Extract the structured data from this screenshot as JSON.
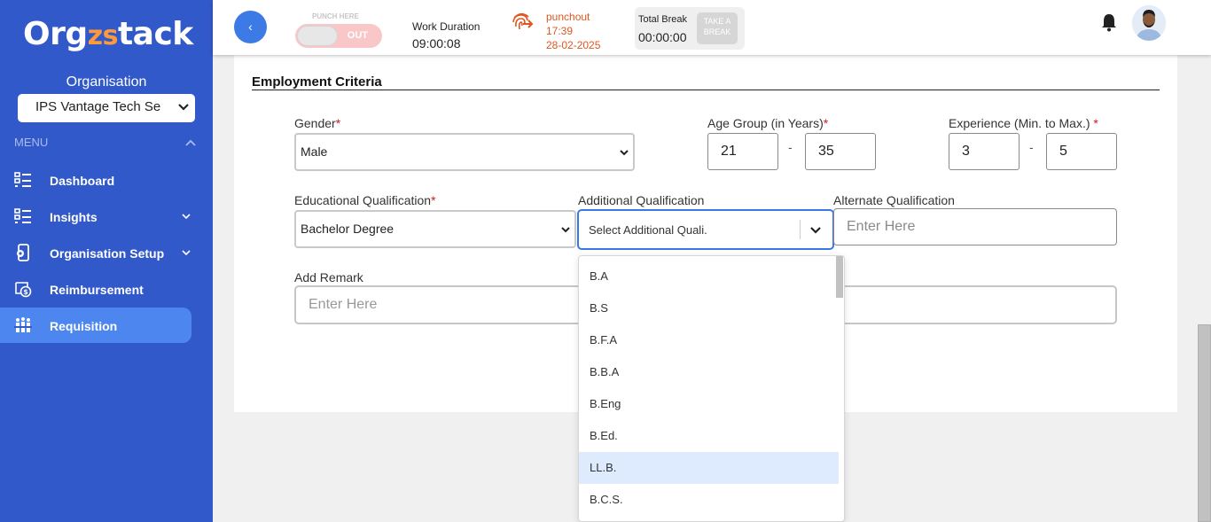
{
  "sidebar": {
    "logo_prefix": "Org",
    "logo_mid": "zs",
    "logo_suffix": "tack",
    "org_label": "Organisation",
    "org_value": "IPS Vantage Tech Se",
    "menu_heading": "MENU",
    "items": [
      {
        "label": "Dashboard",
        "icon": "dashboard-icon",
        "expandable": false,
        "active": false
      },
      {
        "label": "Insights",
        "icon": "insights-icon",
        "expandable": true,
        "active": false
      },
      {
        "label": "Organisation Setup",
        "icon": "organisation-setup-icon",
        "expandable": true,
        "active": false
      },
      {
        "label": "Reimbursement",
        "icon": "reimbursement-icon",
        "expandable": false,
        "active": false
      },
      {
        "label": "Requisition",
        "icon": "requisition-icon",
        "expandable": false,
        "active": true
      }
    ]
  },
  "topbar": {
    "back_symbol": "‹",
    "punch_here": "PUNCH HERE",
    "punch_state": "OUT",
    "work_duration_label": "Work Duration",
    "work_duration_value": "09:00:08",
    "punch_status": "punchout",
    "punch_time": "17:39",
    "punch_date": "28-02-2025",
    "total_break_label": "Total Break",
    "total_break_value": "00:00:00",
    "take_break_line1": "TAKE A",
    "take_break_line2": "BREAK"
  },
  "form": {
    "section_title": "Employment Criteria",
    "gender_label": "Gender",
    "gender_value": "Male",
    "age_label": "Age Group (in Years)",
    "age_min": "21",
    "age_max": "35",
    "experience_label": "Experience (Min. to Max.)",
    "exp_min": "3",
    "exp_max": "5",
    "range_sep": "-",
    "required_mark": "*",
    "edu_label": "Educational Qualification",
    "edu_value": "Bachelor Degree",
    "additional_label": "Additional Qualification",
    "additional_placeholder": "Select Additional Quali.",
    "alternate_label": "Alternate Qualification",
    "alternate_placeholder": "Enter Here",
    "remark_label": "Add Remark",
    "remark_placeholder": "Enter Here"
  },
  "dropdown": {
    "options": [
      "B.A",
      "B.S",
      "B.F.A",
      "B.B.A",
      "B.Eng",
      "B.Ed.",
      "LL.B.",
      "B.C.S."
    ],
    "highlighted_index": 6
  },
  "colors": {
    "sidebar_bg": "#3259c9",
    "active_item": "#4e86f0",
    "accent": "#3b78e7",
    "punch_out": "#e0561e",
    "required": "#d21919"
  }
}
